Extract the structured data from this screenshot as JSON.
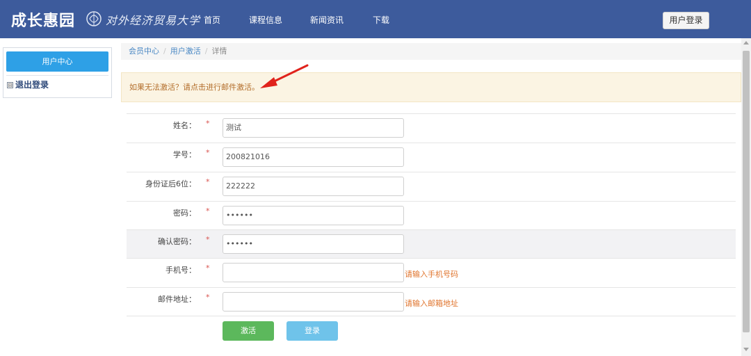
{
  "header": {
    "logo": "成长惠园",
    "university": "对外经济贸易大学",
    "nav": [
      "首页",
      "课程信息",
      "新闻资讯",
      "下载"
    ],
    "login_button": "用户登录"
  },
  "sidebar": {
    "active_item": "用户中心",
    "logout_item": "退出登录",
    "logout_toggle": "⊟"
  },
  "breadcrumb": {
    "items": [
      "会员中心",
      "用户激活",
      "详情"
    ],
    "separator": "/"
  },
  "alert": {
    "text": "如果无法激活？请点击进行邮件激活。"
  },
  "form": {
    "required_mark": "*",
    "fields": [
      {
        "label": "姓名：",
        "value": "测试",
        "hint": ""
      },
      {
        "label": "学号：",
        "value": "200821016",
        "hint": ""
      },
      {
        "label": "身份证后6位：",
        "value": "222222",
        "hint": ""
      },
      {
        "label": "密码：",
        "value": "••••••",
        "hint": ""
      },
      {
        "label": "确认密码：",
        "value": "••••••",
        "hint": ""
      },
      {
        "label": "手机号：",
        "value": "",
        "hint": "请输入手机号码"
      },
      {
        "label": "邮件地址：",
        "value": "",
        "hint": "请输入邮箱地址"
      }
    ],
    "activate_button": "激活",
    "login_button": "登录"
  },
  "colors": {
    "header_bg": "#3d5b9c",
    "sidebar_active": "#2ea0e6",
    "activate_button": "#5cb85c",
    "login_button": "#6fc3ea",
    "hint_text": "#e0752e",
    "required": "#d9534f"
  }
}
